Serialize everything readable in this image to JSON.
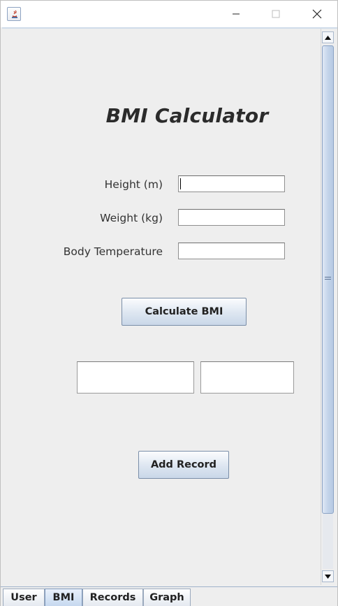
{
  "window": {
    "icon": "java-icon",
    "controls": {
      "minimize": "minimize-icon",
      "maximize": "maximize-icon",
      "close": "close-icon"
    }
  },
  "form": {
    "title": "BMI Calculator",
    "height_label": "Height (m)",
    "height_value": "",
    "weight_label": "Weight (kg)",
    "weight_value": "",
    "temperature_label": "Body Temperature",
    "temperature_value": "",
    "calculate_label": "Calculate BMI",
    "bmi_result": "",
    "status_result": "",
    "add_record_label": "Add Record"
  },
  "tabs": [
    {
      "label": "User",
      "selected": false
    },
    {
      "label": "BMI",
      "selected": true
    },
    {
      "label": "Records",
      "selected": false
    },
    {
      "label": "Graph",
      "selected": false
    }
  ],
  "colors": {
    "accent": "#c6d8ef",
    "button_border": "#7a8ea8",
    "background": "#eeeeee"
  }
}
